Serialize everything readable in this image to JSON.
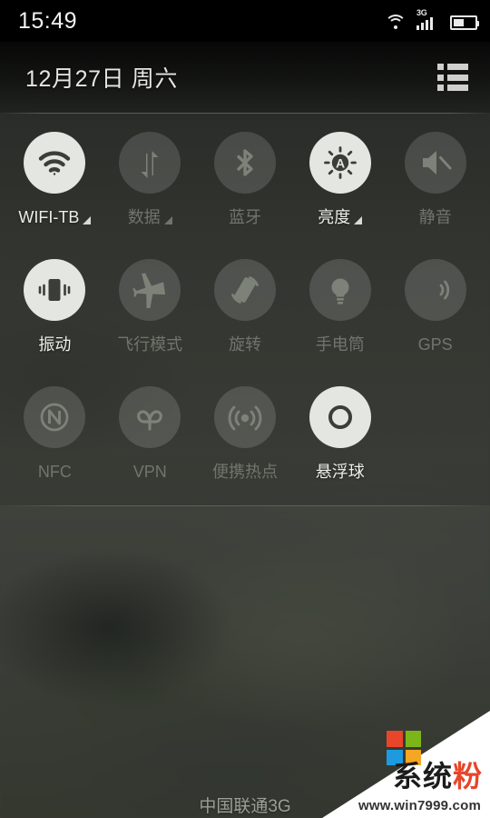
{
  "statusbar": {
    "time": "15:49",
    "wifi_icon": "wifi-icon",
    "signal_label": "3G",
    "signal_icon": "signal-bars-icon",
    "battery_icon": "battery-icon",
    "battery_level_pct": 48
  },
  "header": {
    "date": "12月27日  周六",
    "menu_icon": "list-icon"
  },
  "toggles": {
    "rows": [
      [
        {
          "label": "WIFI-TB",
          "icon": "wifi-icon",
          "active": true,
          "caret": true
        },
        {
          "label": "数据",
          "icon": "data-icon",
          "active": false,
          "caret": true
        },
        {
          "label": "蓝牙",
          "icon": "bluetooth-icon",
          "active": false,
          "caret": false
        },
        {
          "label": "亮度",
          "icon": "brightness-auto-icon",
          "active": true,
          "caret": true
        },
        {
          "label": "静音",
          "icon": "mute-icon",
          "active": false,
          "caret": false
        }
      ],
      [
        {
          "label": "振动",
          "icon": "vibrate-icon",
          "active": true,
          "caret": false
        },
        {
          "label": "飞行模式",
          "icon": "airplane-icon",
          "active": false,
          "caret": false
        },
        {
          "label": "旋转",
          "icon": "rotate-icon",
          "active": false,
          "caret": false
        },
        {
          "label": "手电筒",
          "icon": "flashlight-icon",
          "active": false,
          "caret": false
        },
        {
          "label": "GPS",
          "icon": "gps-icon",
          "active": false,
          "caret": false
        }
      ],
      [
        {
          "label": "NFC",
          "icon": "nfc-icon",
          "active": false,
          "caret": false
        },
        {
          "label": "VPN",
          "icon": "vpn-icon",
          "active": false,
          "caret": false
        },
        {
          "label": "便携热点",
          "icon": "hotspot-icon",
          "active": false,
          "caret": false
        },
        {
          "label": "悬浮球",
          "icon": "floating-ball-icon",
          "active": true,
          "caret": false
        },
        {
          "label": "",
          "icon": "",
          "active": false,
          "caret": false,
          "empty": true
        }
      ]
    ]
  },
  "footer": {
    "carrier": "中国联通3G"
  },
  "watermark": {
    "title_part1": "系统",
    "title_part2": "粉",
    "url": "www.win7999.com",
    "logo_colors": [
      "#e8452a",
      "#7cb518",
      "#1e9ae0",
      "#f5a623"
    ]
  },
  "colors": {
    "active_tile": "#e4e6e1",
    "inactive_tile": "rgba(255,255,255,0.14)",
    "active_label": "#eceee9",
    "inactive_label": "#70756c",
    "background": "#3a3d38"
  }
}
